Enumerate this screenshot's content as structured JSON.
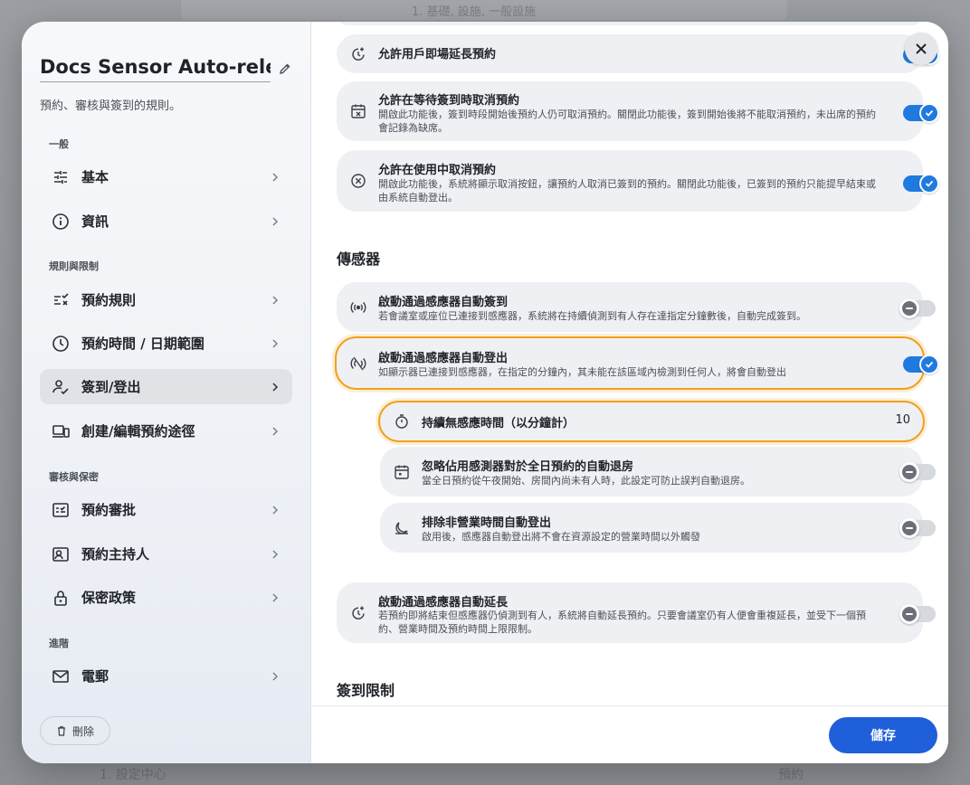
{
  "backdrop": {
    "top_text": "1. 基礎, 設施, 一般設施",
    "bottom_text": "1. 設定中心",
    "bottom_right": "預約"
  },
  "sidebar": {
    "title": "Docs Sensor Auto-releas",
    "subtitle": "預約、審核與簽到的規則。",
    "sections": [
      {
        "label": "一般",
        "items": [
          {
            "label": "基本",
            "icon": "sliders-icon"
          },
          {
            "label": "資訊",
            "icon": "info-icon"
          }
        ]
      },
      {
        "label": "規則與限制",
        "items": [
          {
            "label": "預約規則",
            "icon": "rules-icon"
          },
          {
            "label": "預約時間 / 日期範圍",
            "icon": "clock-icon"
          },
          {
            "label": "簽到/登出",
            "icon": "user-check-icon",
            "active": true
          },
          {
            "label": "創建/編輯預約途徑",
            "icon": "devices-icon"
          }
        ]
      },
      {
        "label": "審核與保密",
        "items": [
          {
            "label": "預約審批",
            "icon": "approval-icon"
          },
          {
            "label": "預約主持人",
            "icon": "host-icon"
          },
          {
            "label": "保密政策",
            "icon": "lock-icon"
          }
        ]
      },
      {
        "label": "進階",
        "items": [
          {
            "label": "電郵",
            "icon": "mail-icon"
          }
        ]
      }
    ],
    "delete_label": "刪除"
  },
  "main": {
    "cards_top": [
      {
        "title": "允許用戶即場延長預約",
        "desc": "",
        "toggle": true,
        "icon": "clock-plus-icon"
      },
      {
        "title": "允許在等待簽到時取消預約",
        "desc": "開啟此功能後，簽到時段開始後預約人仍可取消預約。關閉此功能後，簽到開始後將不能取消預約，未出席的預約會記錄為缺席。",
        "toggle": true,
        "icon": "calendar-x-icon"
      },
      {
        "title": "允許在使用中取消預約",
        "desc": "開啟此功能後，系統將顯示取消按鈕，讓預約人取消已簽到的預約。關閉此功能後，已簽到的預約只能提早結束或由系統自動登出。",
        "toggle": true,
        "icon": "circle-x-icon"
      }
    ],
    "sensor_heading": "傳感器",
    "sensor_cards": [
      {
        "title": "啟動通過感應器自動簽到",
        "desc": "若會議室或座位已連接到感應器，系統將在持續偵測到有人存在達指定分鐘數後，自動完成簽到。",
        "toggle": false,
        "icon": "sensor-icon"
      },
      {
        "title": "啟動通過感應器自動登出",
        "desc": "如顯示器已連接到感應器，在指定的分鐘內，其未能在該區域內檢測到任何人，將會自動登出",
        "toggle": true,
        "icon": "sensor-off-icon"
      }
    ],
    "sub_cards": {
      "duration": {
        "title": "持續無感應時間（以分鐘計）",
        "value": "10"
      },
      "ignore": {
        "title": "忽略佔用感測器對於全日預約的自動退房",
        "desc": "當全日預約從午夜開始、房間內尚未有人時，此設定可防止誤判自動退房。",
        "toggle": false
      },
      "exclude": {
        "title": "排除非營業時間自動登出",
        "desc": "啟用後，感應器自動登出將不會在資源設定的營業時間以外觸發",
        "toggle": false
      }
    },
    "extend_card": {
      "title": "啟動通過感應器自動延長",
      "desc": "若預約即將結束但感應器仍偵測到有人，系統將自動延長預約。只要會議室仍有人便會重複延長，並受下一個預約、營業時間及預約時間上限限制。",
      "toggle": false
    },
    "checkin_heading": "簽到限制"
  },
  "footer": {
    "save_label": "儲存"
  }
}
